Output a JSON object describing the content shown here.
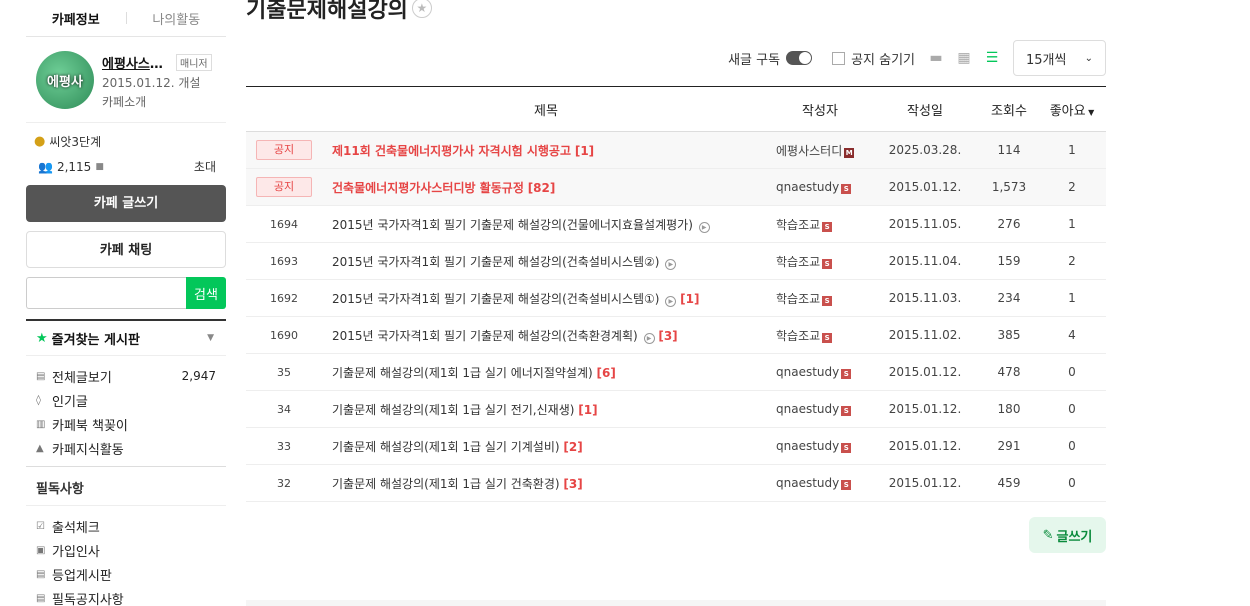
{
  "sidebar": {
    "tabs": [
      "카페정보",
      "나의활동"
    ],
    "cafe": {
      "logo_text": "에평사",
      "name": "에평사스터디방",
      "role": "매니저",
      "date": "2015.01.12. 개설",
      "intro": "카페소개"
    },
    "level": "씨앗3단계",
    "members": "2,115",
    "invite": "초대",
    "write_btn": "카페 글쓰기",
    "chat_btn": "카페 채팅",
    "search_btn": "검색",
    "fav_title": "즐겨찾는 게시판",
    "boards": [
      {
        "label": "전체글보기",
        "count": "2,947"
      },
      {
        "label": "인기글",
        "count": ""
      },
      {
        "label": "카페북 책꽂이",
        "count": ""
      },
      {
        "label": "카페지식활동",
        "count": ""
      }
    ],
    "section2": "필독사항",
    "boards2": [
      {
        "label": "출석체크"
      },
      {
        "label": "가입인사"
      },
      {
        "label": "등업게시판"
      },
      {
        "label": "필독공지사항"
      }
    ]
  },
  "main": {
    "title": "기출문제해설강의",
    "subscribe": "새글 구독",
    "hide_notice": "공지 숨기기",
    "per_page": "15개씩",
    "write": "글쓰기",
    "columns": [
      "제목",
      "작성자",
      "작성일",
      "조회수",
      "좋아요"
    ],
    "rows": [
      {
        "no": "공지",
        "title": "제11회 건축물에너지평가사 자격시험 시행공고",
        "reply": "[1]",
        "author": "에평사스터디",
        "date": "2025.03.28.",
        "views": "114",
        "likes": "1",
        "notice": true,
        "badge": "M",
        "media": false
      },
      {
        "no": "공지",
        "title": "건축물에너지평가사스터디방 활동규정",
        "reply": "[82]",
        "author": "qnaestudy",
        "date": "2015.01.12.",
        "views": "1,573",
        "likes": "2",
        "notice": true,
        "badge": "S",
        "media": false
      },
      {
        "no": "1694",
        "title": "2015년 국가자격1회 필기 기출문제 해설강의(건물에너지효율설계평가)",
        "reply": "",
        "author": "학습조교",
        "date": "2015.11.05.",
        "views": "276",
        "likes": "1",
        "notice": false,
        "badge": "S",
        "media": true
      },
      {
        "no": "1693",
        "title": "2015년 국가자격1회 필기 기출문제 해설강의(건축설비시스템②)",
        "reply": "",
        "author": "학습조교",
        "date": "2015.11.04.",
        "views": "159",
        "likes": "2",
        "notice": false,
        "badge": "S",
        "media": true
      },
      {
        "no": "1692",
        "title": "2015년 국가자격1회 필기 기출문제 해설강의(건축설비시스템①)",
        "reply": "[1]",
        "author": "학습조교",
        "date": "2015.11.03.",
        "views": "234",
        "likes": "1",
        "notice": false,
        "badge": "S",
        "media": true
      },
      {
        "no": "1690",
        "title": "2015년 국가자격1회 필기 기출문제 해설강의(건축환경계획)",
        "reply": "[3]",
        "author": "학습조교",
        "date": "2015.11.02.",
        "views": "385",
        "likes": "4",
        "notice": false,
        "badge": "S",
        "media": true
      },
      {
        "no": "35",
        "title": "기출문제 해설강의(제1회 1급 실기 에너지절약설계)",
        "reply": "[6]",
        "author": "qnaestudy",
        "date": "2015.01.12.",
        "views": "478",
        "likes": "0",
        "notice": false,
        "badge": "S",
        "media": false
      },
      {
        "no": "34",
        "title": "기출문제 해설강의(제1회 1급 실기 전기,신재생)",
        "reply": "[1]",
        "author": "qnaestudy",
        "date": "2015.01.12.",
        "views": "180",
        "likes": "0",
        "notice": false,
        "badge": "S",
        "media": false
      },
      {
        "no": "33",
        "title": "기출문제 해설강의(제1회 1급 실기 기계설비)",
        "reply": "[2]",
        "author": "qnaestudy",
        "date": "2015.01.12.",
        "views": "291",
        "likes": "0",
        "notice": false,
        "badge": "S",
        "media": false
      },
      {
        "no": "32",
        "title": "기출문제 해설강의(제1회 1급 실기 건축환경)",
        "reply": "[3]",
        "author": "qnaestudy",
        "date": "2015.01.12.",
        "views": "459",
        "likes": "0",
        "notice": false,
        "badge": "S",
        "media": false
      }
    ]
  }
}
